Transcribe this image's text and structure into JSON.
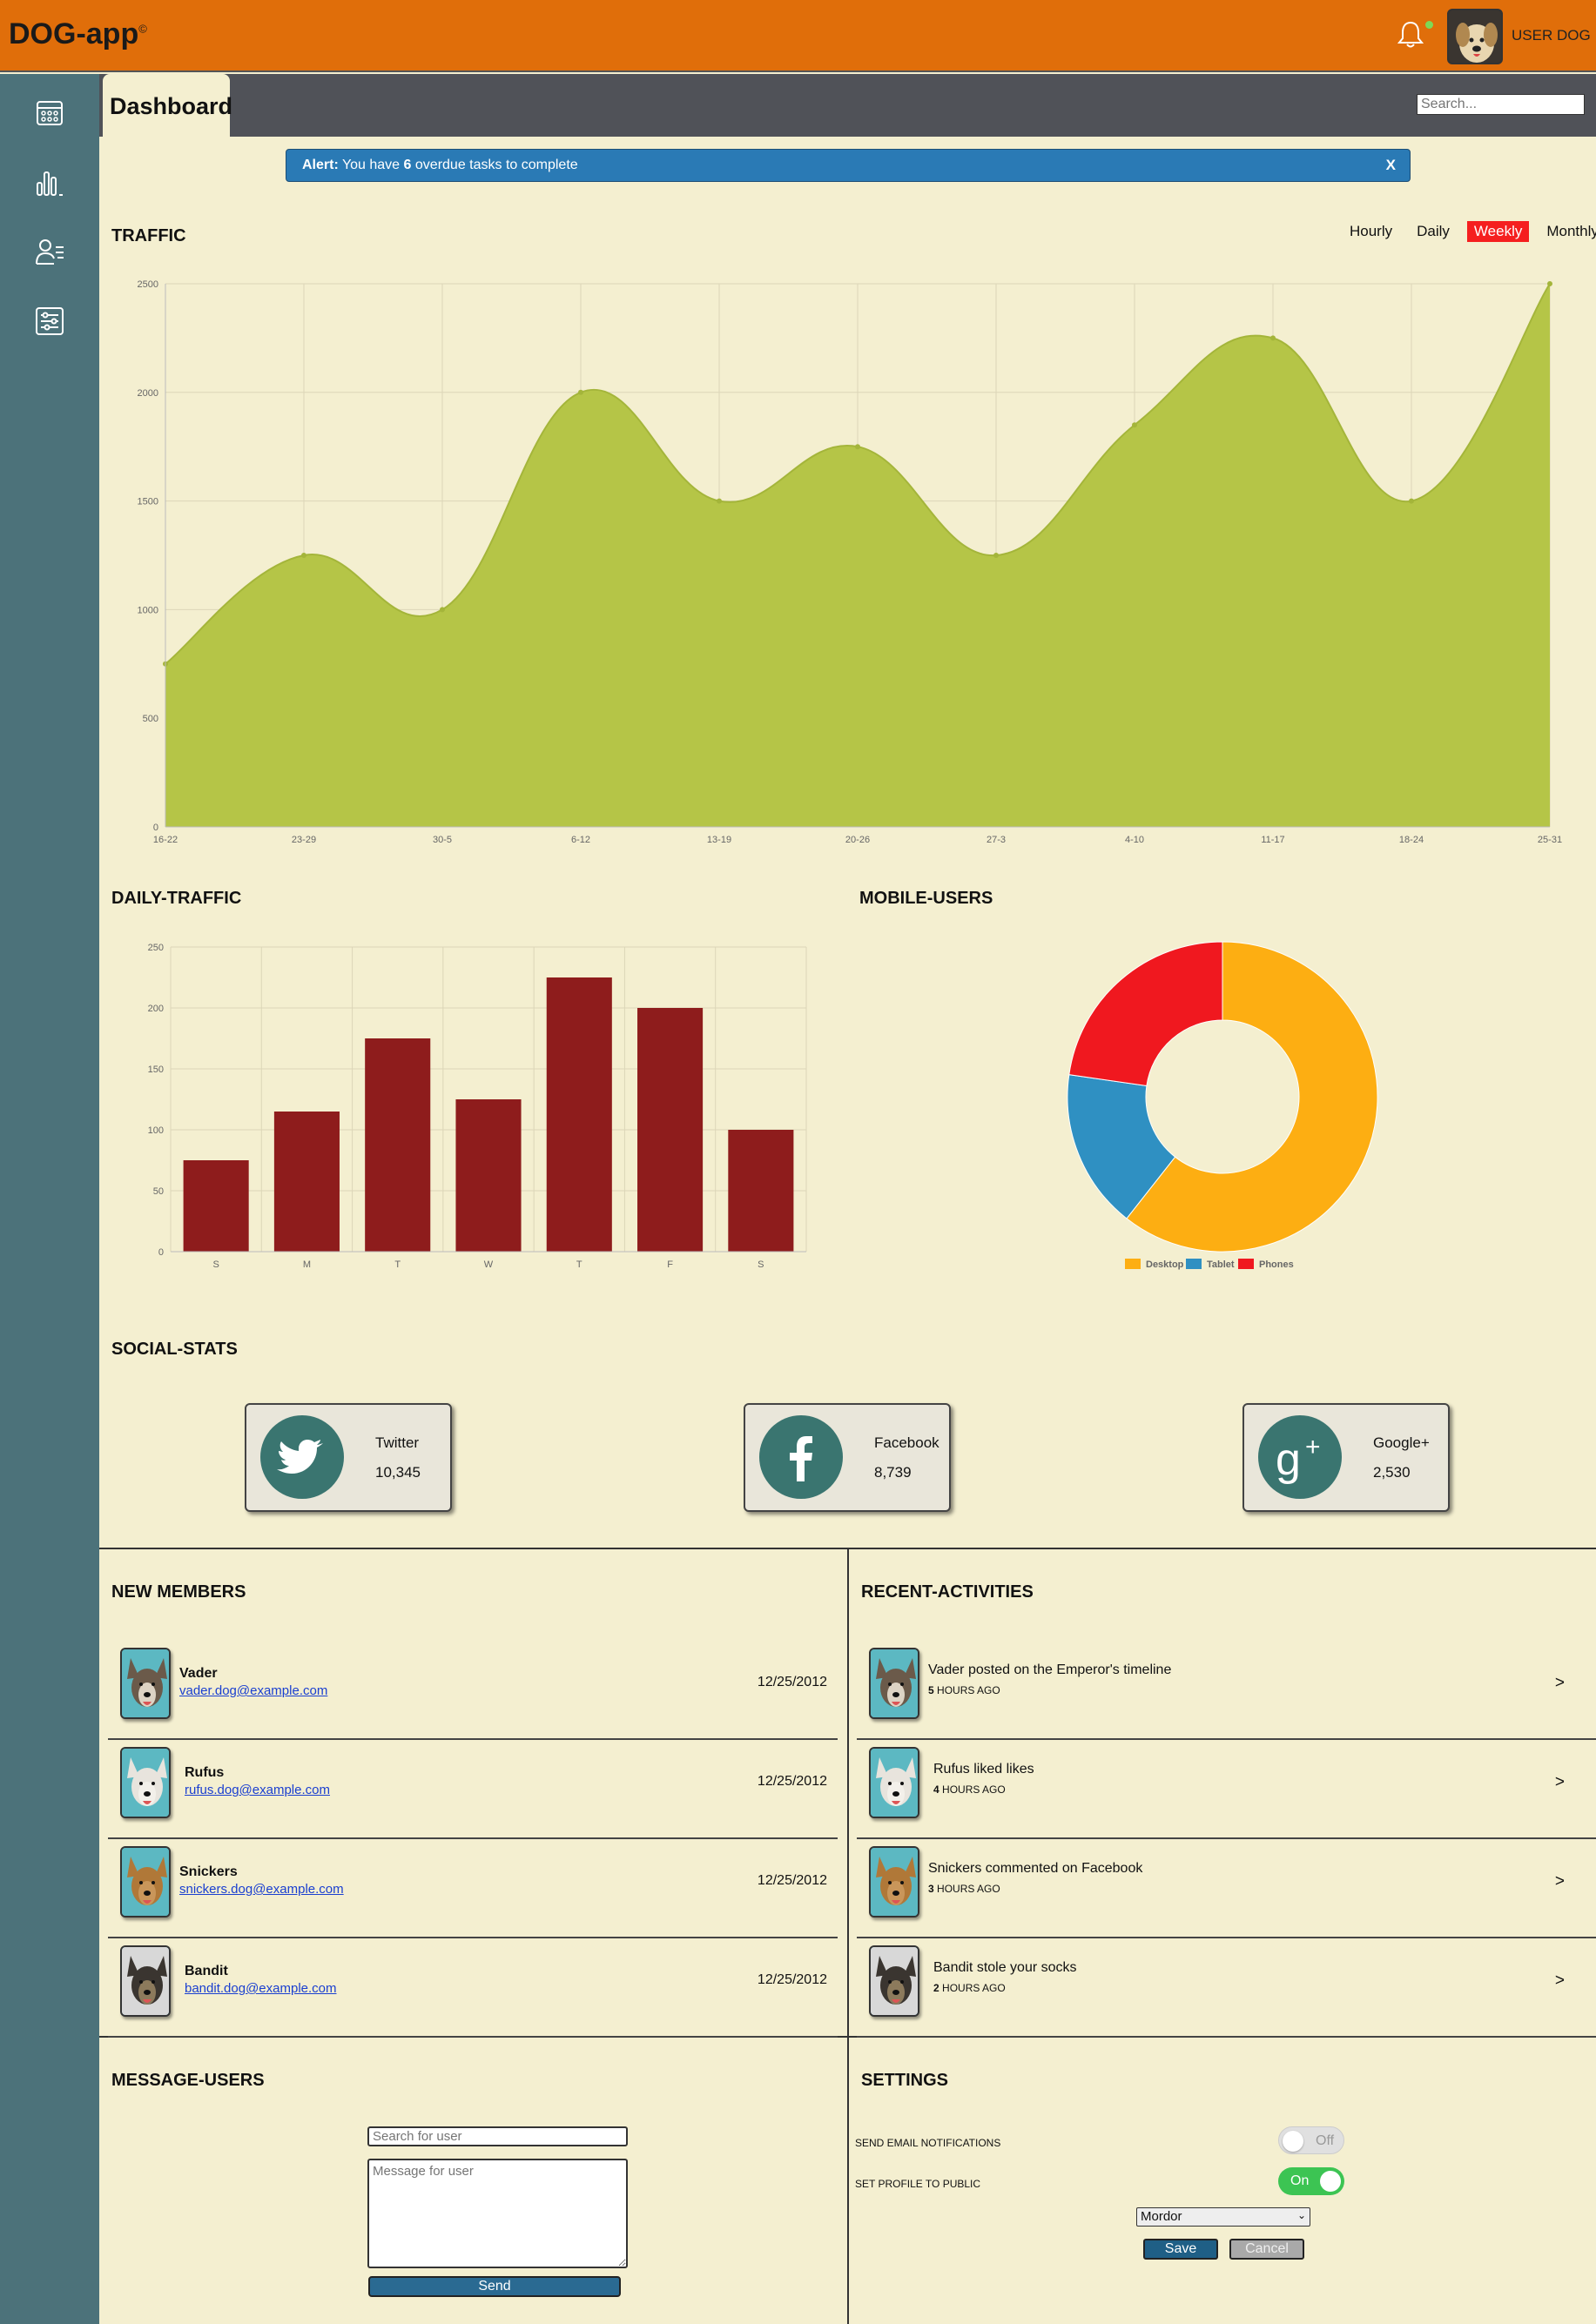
{
  "header": {
    "logo": "DOG-app",
    "logo_mark": "©",
    "user_name": "USER DOG",
    "notification_icon": "bell-icon",
    "status_color": "#7ed957",
    "accent_color": "#e06e0a"
  },
  "sidebar": {
    "items": [
      {
        "icon": "calendar-icon"
      },
      {
        "icon": "bar-chart-icon"
      },
      {
        "icon": "users-list-icon"
      },
      {
        "icon": "settings-sliders-icon"
      }
    ]
  },
  "subheader": {
    "tab": "Dashboard",
    "search_placeholder": "Search..."
  },
  "alert": {
    "label": "Alert:",
    "text_before": "You have",
    "count": "6",
    "text_after": "overdue tasks to complete",
    "close": "X"
  },
  "traffic": {
    "title": "TRAFFIC",
    "tabs": [
      "Hourly",
      "Daily",
      "Weekly",
      "Monthly"
    ],
    "active_tab": "Weekly"
  },
  "daily_traffic": {
    "title": "DAILY-TRAFFIC"
  },
  "mobile_users": {
    "title": "MOBILE-USERS"
  },
  "chart_data": [
    {
      "type": "area",
      "x": [
        "16-22",
        "23-29",
        "30-5",
        "6-12",
        "13-19",
        "20-26",
        "27-3",
        "4-10",
        "11-17",
        "18-24",
        "25-31"
      ],
      "values": [
        750,
        1250,
        1000,
        2000,
        1500,
        1750,
        1250,
        1850,
        2250,
        1500,
        2500
      ],
      "yticks": [
        0,
        500,
        1000,
        1500,
        2000,
        2500
      ],
      "ylim": [
        0,
        2500
      ],
      "color": "#b5c547",
      "grid": true
    },
    {
      "type": "bar",
      "categories": [
        "S",
        "M",
        "T",
        "W",
        "T",
        "F",
        "S"
      ],
      "values": [
        75,
        115,
        175,
        125,
        225,
        200,
        100
      ],
      "yticks": [
        0,
        50,
        100,
        150,
        200,
        250
      ],
      "ylim": [
        0,
        250
      ],
      "color": "#8e1c1c",
      "grid": true
    },
    {
      "type": "pie",
      "labels": [
        "Desktop",
        "Tablet",
        "Phones"
      ],
      "values": [
        2000,
        550,
        750
      ],
      "colors": [
        "#fdae12",
        "#2f90c2",
        "#f0181f"
      ],
      "legend": "bottom"
    }
  ],
  "social": {
    "title": "SOCIAL-STATS",
    "items": [
      {
        "name": "Twitter",
        "count": "10,345",
        "icon": "twitter-icon"
      },
      {
        "name": "Facebook",
        "count": "8,739",
        "icon": "facebook-icon"
      },
      {
        "name": "Google+",
        "count": "2,530",
        "icon": "google-plus-icon"
      }
    ]
  },
  "members": {
    "title": "NEW MEMBERS",
    "items": [
      {
        "name": "Vader",
        "email": "vader.dog@example.com",
        "date": "12/25/2012"
      },
      {
        "name": "Rufus",
        "email": "rufus.dog@example.com",
        "date": "12/25/2012"
      },
      {
        "name": "Snickers",
        "email": "snickers.dog@example.com",
        "date": "12/25/2012"
      },
      {
        "name": "Bandit",
        "email": "bandit.dog@example.com",
        "date": "12/25/2012"
      }
    ]
  },
  "activities": {
    "title": "RECENT-ACTIVITIES",
    "items": [
      {
        "text": "Vader posted on the Emperor's timeline",
        "time_num": "5",
        "time_unit": "HOURS AGO",
        "arrow": ">"
      },
      {
        "text": "Rufus liked likes",
        "time_num": "4",
        "time_unit": "HOURS AGO",
        "arrow": ">"
      },
      {
        "text": "Snickers commented on Facebook",
        "time_num": "3",
        "time_unit": "HOURS AGO",
        "arrow": ">"
      },
      {
        "text": "Bandit stole your socks",
        "time_num": "2",
        "time_unit": "HOURS AGO",
        "arrow": ">"
      }
    ]
  },
  "message": {
    "title": "MESSAGE-USERS",
    "search_placeholder": "Search for user",
    "message_placeholder": "Message for user",
    "send": "Send"
  },
  "settings": {
    "title": "SETTINGS",
    "email_label": "SEND EMAIL NOTIFICATIONS",
    "email_state": "Off",
    "profile_label": "SET PROFILE TO PUBLIC",
    "profile_state": "On",
    "timezone": "Mordor",
    "save": "Save",
    "cancel": "Cancel"
  }
}
